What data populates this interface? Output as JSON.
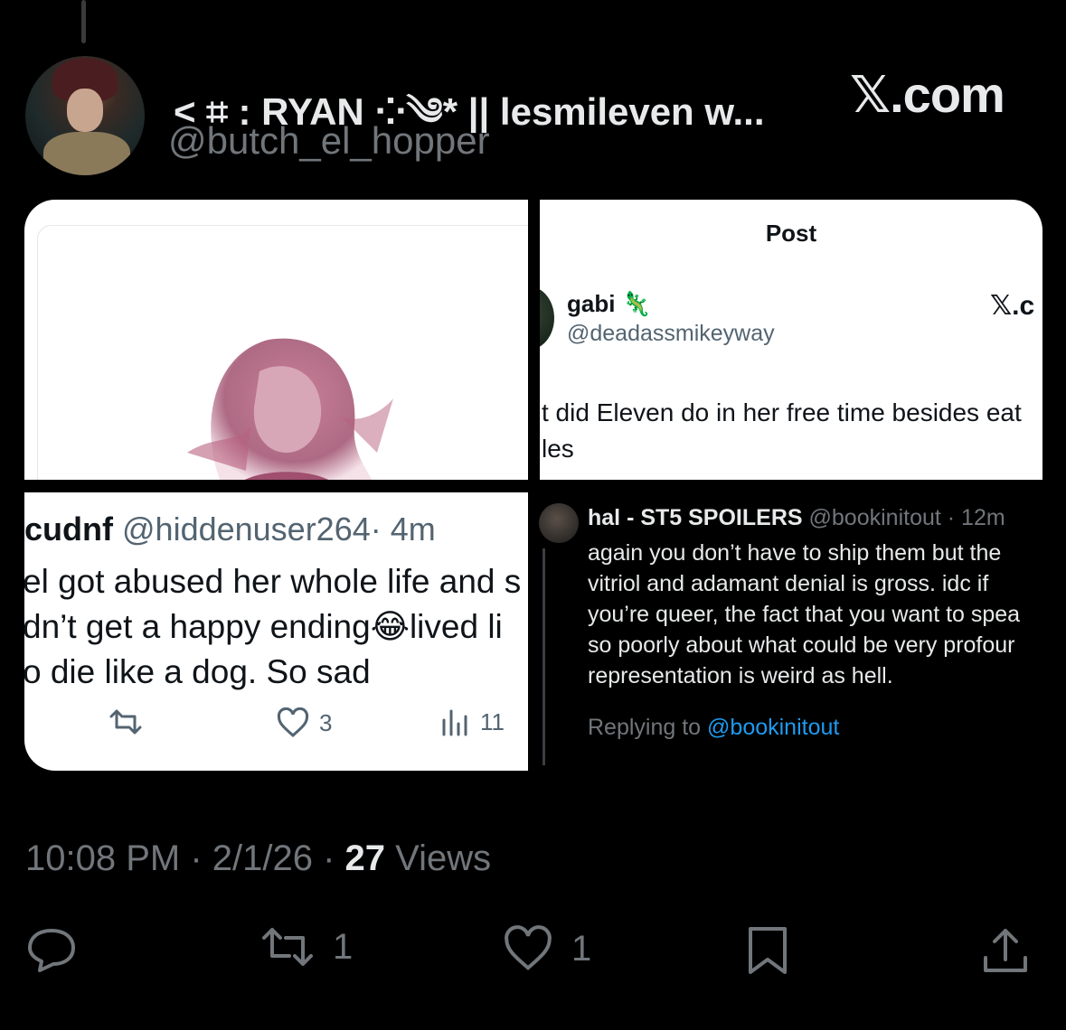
{
  "author": {
    "display_name": "< ⌗ : RYAN ⁘༄* || lesmileven w...",
    "handle": "@butch_el_hopper",
    "source": "𝕏.com"
  },
  "quoted": {
    "post_header": "Post",
    "gabi": {
      "name": "gabi 🦎",
      "handle": "@deadassmikeyway",
      "source": "𝕏.c",
      "text_line1": "t did Eleven do in her free time besides eat",
      "text_line2": "les"
    },
    "cudnf": {
      "name": "cudnf",
      "handle": "@hiddenuser264",
      "time": "· 4m",
      "text": "el got abused her whole life and s\ndn’t get a happy ending😂lived li\no die like a dog. So sad",
      "likes": "3",
      "views": "11"
    },
    "hal": {
      "name": "hal - ST5 SPOILERS",
      "handle": "@bookinitout",
      "time": "· 12m",
      "text": "again you don’t have to ship them but the\nvitriol and adamant denial is gross. idc if\nyou’re queer, the fact that you want to spea\nso poorly about what could be very profour\nrepresentation is weird as hell.",
      "replying_prefix": "Replying to",
      "replying_handle": "@bookinitout"
    }
  },
  "meta": {
    "time": "10:08 PM",
    "date": "2/1/26",
    "views_count": "27",
    "views_label": "Views"
  },
  "actions": {
    "reposts": "1",
    "likes": "1"
  },
  "colors": {
    "background": "#000000",
    "muted": "#71767b",
    "link": "#1d9bf0"
  }
}
